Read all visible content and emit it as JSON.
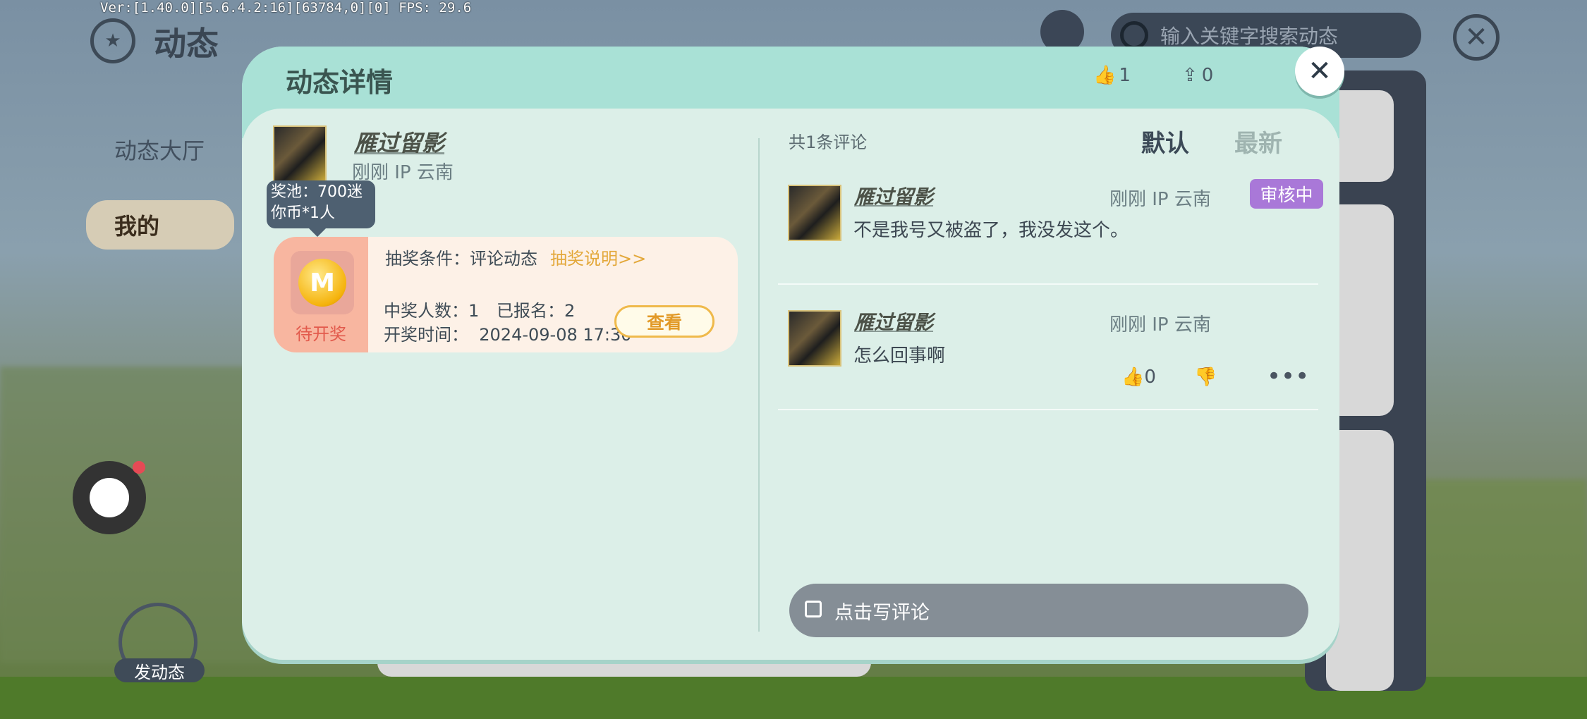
{
  "debug": {
    "version": "Ver:[1.40.0][5.6.4.2:16][63784,0][0] FPS: 29.6"
  },
  "background": {
    "page_title": "动态",
    "tabs": [
      "动态大厅",
      "我的"
    ],
    "search_placeholder": "输入关键字搜索动态",
    "post_label": "发动态"
  },
  "modal": {
    "title": "动态详情",
    "like_count": "1",
    "share_count": "0",
    "post": {
      "username": "雁过留影",
      "meta": "刚刚 IP 云南",
      "tooltip": "奖池：700迷你币*1人",
      "lottery": {
        "status": "待开奖",
        "condition": "抽奖条件：评论动态",
        "rules_link": "抽奖说明>>",
        "winners": "中奖人数：1",
        "registered": "已报名：2",
        "draw_time": "开奖时间：  2024-09-08 17:30",
        "view_button": "查看"
      }
    },
    "comments_header": {
      "count": "共1条评论",
      "sort_default": "默认",
      "sort_latest": "最新"
    },
    "comments": [
      {
        "username": "雁过留影",
        "meta": "刚刚 IP 云南",
        "badge": "审核中",
        "text": "不是我号又被盗了，我没发这个。"
      },
      {
        "username": "雁过留影",
        "meta": "刚刚 IP 云南",
        "text": "怎么回事啊",
        "likes": "0"
      }
    ],
    "write_placeholder": "点击写评论"
  }
}
